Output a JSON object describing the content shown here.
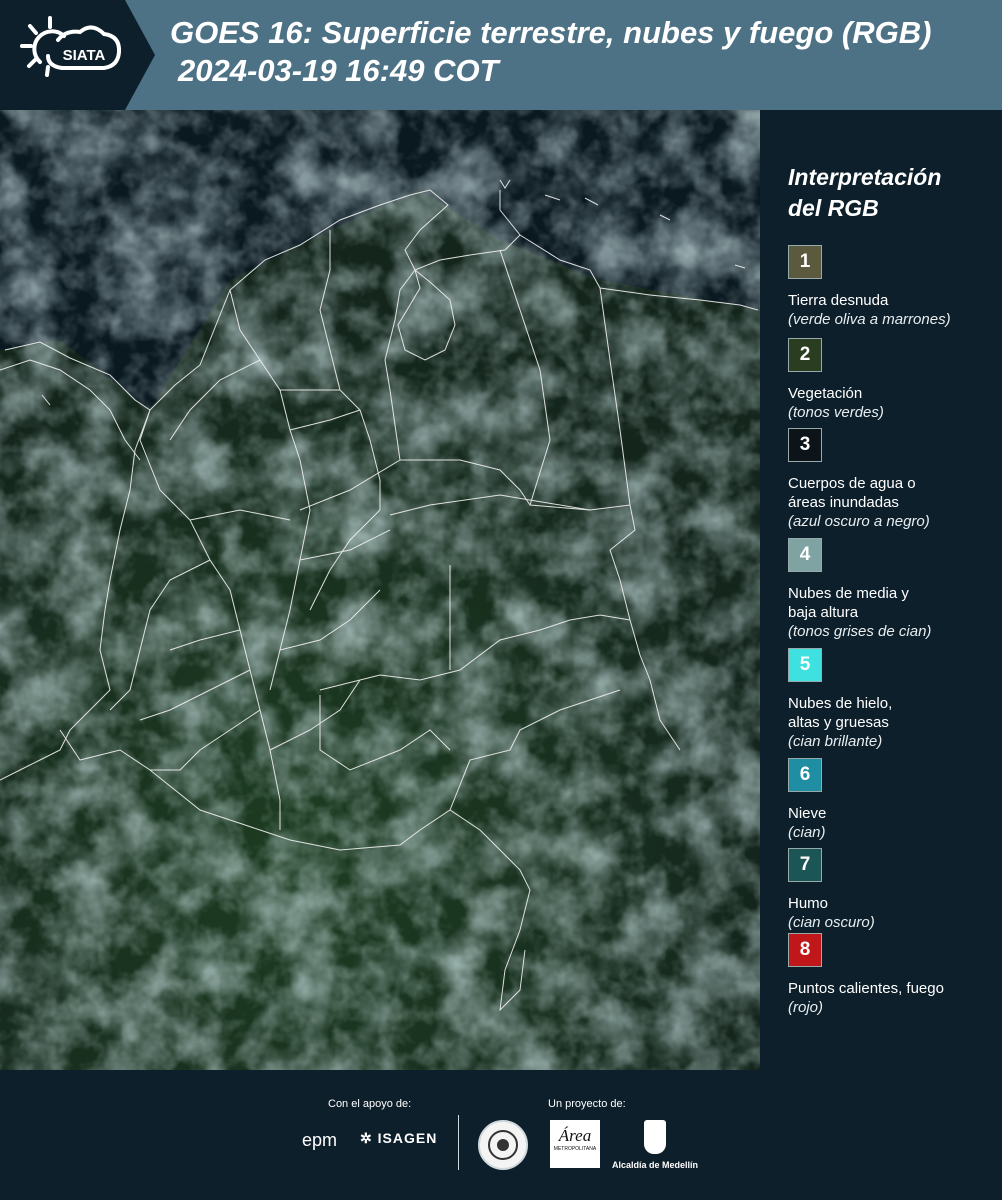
{
  "header": {
    "logo_text": "SIATA",
    "title_line1": "GOES 16: Superficie terrestre, nubes y fuego (RGB)",
    "title_line2": "2024-03-19 16:49 COT"
  },
  "legend": {
    "title_line1": "Interpretación",
    "title_line2": "del RGB",
    "items": [
      {
        "num": "1",
        "color": "#5b5a3e",
        "label": "Tierra desnuda",
        "label2": "",
        "sub": "(verde oliva a marrones)"
      },
      {
        "num": "2",
        "color": "#2a3d20",
        "label": "Vegetación",
        "label2": "",
        "sub": "(tonos verdes)"
      },
      {
        "num": "3",
        "color": "#0c1419",
        "label": "Cuerpos de agua o",
        "label2": "áreas inundadas",
        "sub": "(azul oscuro a negro)"
      },
      {
        "num": "4",
        "color": "#7fa3a3",
        "label": "Nubes de media y",
        "label2": "baja altura",
        "sub": "(tonos grises de cian)"
      },
      {
        "num": "5",
        "color": "#3ee0e0",
        "label": "Nubes de hielo,",
        "label2": "altas y gruesas",
        "sub": "(cian brillante)"
      },
      {
        "num": "6",
        "color": "#1f8ea3",
        "label": "Nieve",
        "label2": "",
        "sub": "(cian)"
      },
      {
        "num": "7",
        "color": "#1c5555",
        "label": "Humo",
        "label2": "",
        "sub": "(cian oscuro)"
      },
      {
        "num": "8",
        "color": "#c0171b",
        "label": "Puntos calientes, fuego",
        "label2": "",
        "sub": "(rojo)"
      }
    ]
  },
  "footer": {
    "support_label": "Con el apoyo de:",
    "project_label": "Un proyecto de:",
    "sponsor1": "epm",
    "sponsor2": "ISAGEN",
    "partner1": "Área",
    "partner1_sub": "METROPOLITANA",
    "partner2": "Alcaldía de Medellín"
  }
}
